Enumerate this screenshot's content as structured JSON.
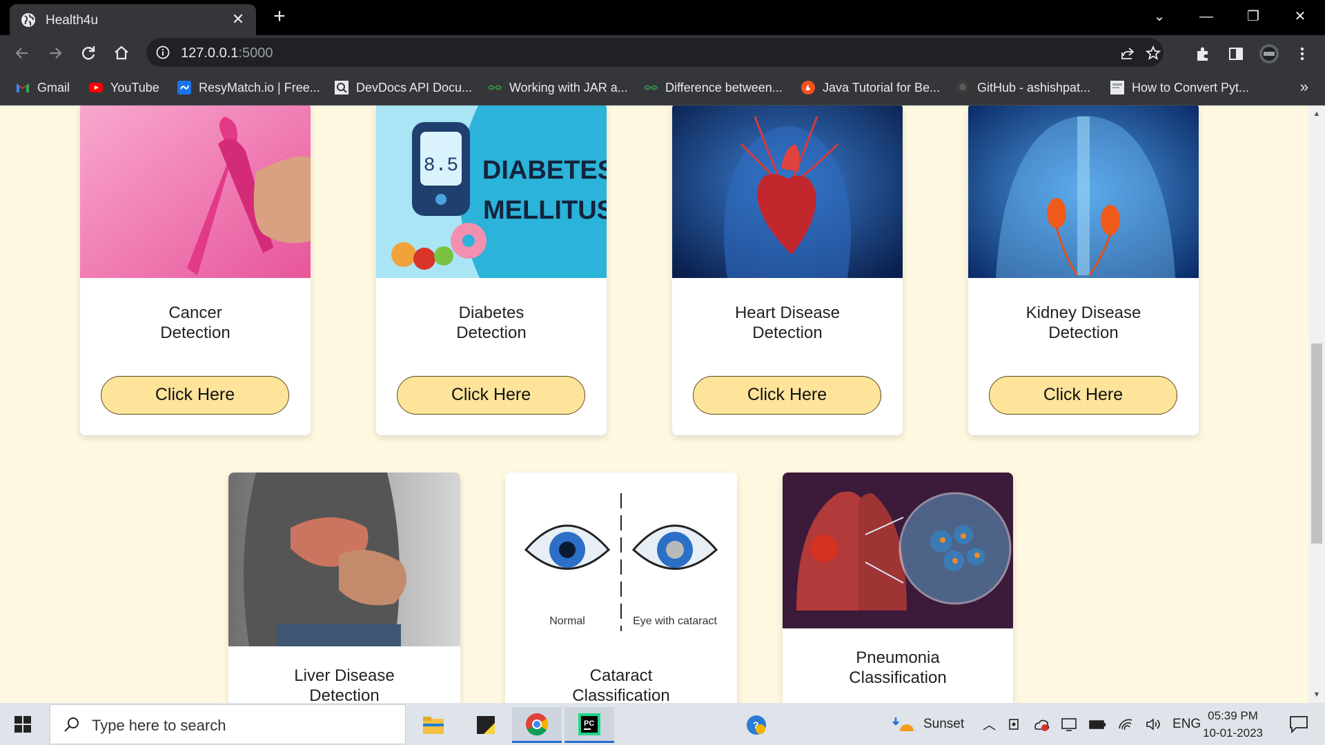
{
  "browser": {
    "tab_title": "Health4u",
    "url_host": "127.0.0.1",
    "url_port": ":5000"
  },
  "bookmarks": [
    {
      "label": "Gmail",
      "icon": "gmail-icon"
    },
    {
      "label": "YouTube",
      "icon": "youtube-icon"
    },
    {
      "label": "ResyMatch.io | Free...",
      "icon": "resymatch-icon"
    },
    {
      "label": "DevDocs API Docu...",
      "icon": "devdocs-icon"
    },
    {
      "label": "Working with JAR a...",
      "icon": "gfg-icon"
    },
    {
      "label": "Difference between...",
      "icon": "gfg-icon"
    },
    {
      "label": "Java Tutorial for Be...",
      "icon": "java-tutorial-icon"
    },
    {
      "label": "GitHub - ashishpat...",
      "icon": "github-icon"
    },
    {
      "label": "How to Convert Pyt...",
      "icon": "page-icon"
    }
  ],
  "cards": [
    {
      "title_line1": "Cancer",
      "title_line2": "Detection",
      "button": "Click Here"
    },
    {
      "title_line1": "Diabetes",
      "title_line2": "Detection",
      "button": "Click Here",
      "image_text": {
        "reading": "8.5",
        "line1": "DIABETES",
        "line2": "MELLITUS"
      }
    },
    {
      "title_line1": "Heart Disease",
      "title_line2": "Detection",
      "button": "Click Here"
    },
    {
      "title_line1": "Kidney Disease",
      "title_line2": "Detection",
      "button": "Click Here"
    },
    {
      "title_line1": "Liver Disease",
      "title_line2": "Detection"
    },
    {
      "title_line1": "Cataract",
      "title_line2": "Classification",
      "image_text": {
        "left": "Normal",
        "right": "Eye with cataract"
      }
    },
    {
      "title_line1": "Pneumonia",
      "title_line2": "Classification"
    }
  ],
  "taskbar": {
    "search_placeholder": "Type here to search",
    "weather": "Sunset",
    "language": "ENG",
    "time": "05:39 PM",
    "date": "10-01-2023"
  }
}
